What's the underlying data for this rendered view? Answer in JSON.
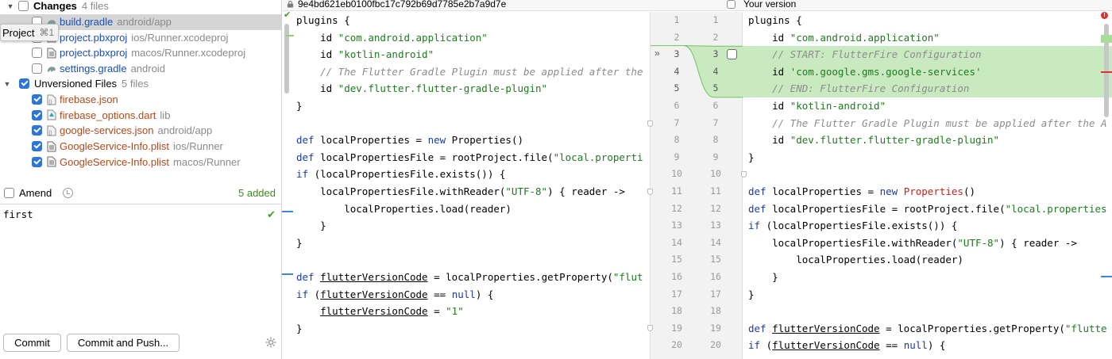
{
  "changes_panel": {
    "changes_group": {
      "label": "Changes",
      "count": "4 files"
    },
    "tooltip": {
      "label": "Project",
      "shortcut": "⌘1"
    },
    "changed_files": [
      {
        "name": "build.gradle",
        "path": "android/app"
      },
      {
        "name": "project.pbxproj",
        "path": "ios/Runner.xcodeproj"
      },
      {
        "name": "project.pbxproj",
        "path": "macos/Runner.xcodeproj"
      },
      {
        "name": "settings.gradle",
        "path": "android"
      }
    ],
    "unversioned_group": {
      "label": "Unversioned Files",
      "count": "5 files"
    },
    "unversioned_files": [
      {
        "name": "firebase.json",
        "path": ""
      },
      {
        "name": "firebase_options.dart",
        "path": "lib"
      },
      {
        "name": "google-services.json",
        "path": "android/app"
      },
      {
        "name": "GoogleService-Info.plist",
        "path": "ios/Runner"
      },
      {
        "name": "GoogleService-Info.plist",
        "path": "macos/Runner"
      }
    ],
    "amend_label": "Amend",
    "added_count": "5 added",
    "commit_message": "first",
    "commit_button": "Commit",
    "commit_push_button": "Commit and Push..."
  },
  "diff": {
    "left_header": "9e4bd621eb0100fbc17c792b69d7785e2b7a9d7e",
    "right_header": "Your version",
    "left_lines": [
      "plugins {",
      "    id \"com.android.application\"",
      "    id \"kotlin-android\"",
      "    // The Flutter Gradle Plugin must be applied after the",
      "    id \"dev.flutter.flutter-gradle-plugin\"",
      "}",
      "",
      "def localProperties = new Properties()",
      "def localPropertiesFile = rootProject.file(\"local.properti",
      "if (localPropertiesFile.exists()) {",
      "    localPropertiesFile.withReader(\"UTF-8\") { reader ->",
      "        localProperties.load(reader)",
      "    }",
      "}",
      "",
      "def flutterVersionCode = localProperties.getProperty(\"flut",
      "if (flutterVersionCode == null) {",
      "    flutterVersionCode = \"1\"",
      "}"
    ],
    "right_lines": [
      "plugins {",
      "    id \"com.android.application\"",
      "    // START: FlutterFire Configuration",
      "    id 'com.google.gms.google-services'",
      "    // END: FlutterFire Configuration",
      "    id \"kotlin-android\"",
      "    // The Flutter Gradle Plugin must be applied after the A",
      "    id \"dev.flutter.flutter-gradle-plugin\"",
      "}",
      "",
      "def localProperties = new Properties()",
      "def localPropertiesFile = rootProject.file(\"local.properties",
      "if (localPropertiesFile.exists()) {",
      "    localPropertiesFile.withReader(\"UTF-8\") { reader ->",
      "        localProperties.load(reader)",
      "    }",
      "}",
      "",
      "def flutterVersionCode = localProperties.getProperty(\"flutte",
      "if (flutterVersionCode == null) {"
    ],
    "line_numbers_left": [
      "1",
      "2",
      "3",
      "4",
      "5",
      "6",
      "7",
      "8",
      "9",
      "10",
      "11",
      "12",
      "13",
      "14",
      "15",
      "16",
      "17",
      "18",
      "19",
      "20"
    ],
    "line_numbers_right": [
      "1",
      "2",
      "3",
      "4",
      "5",
      "6",
      "7",
      "8",
      "9",
      "10",
      "11",
      "12",
      "13",
      "14",
      "15",
      "16",
      "17",
      "18",
      "19",
      "20"
    ],
    "added_block": {
      "right_first_line": 3,
      "right_last_line": 5,
      "left_after_line": 2
    },
    "colors": {
      "added_bg": "#c9eac0",
      "keyword": "#1d3ba6",
      "string": "#1f7a1f",
      "comment": "#8c8c8c",
      "class": "#c0261f",
      "error_marker": "#d9342b",
      "file_modified": "#1a4eb3",
      "file_unversioned": "#b0491a"
    },
    "icons": {
      "apply_change": "double-chevron-right-icon",
      "inspection_ok": "check-icon",
      "inspection_error": "error-icon"
    }
  }
}
